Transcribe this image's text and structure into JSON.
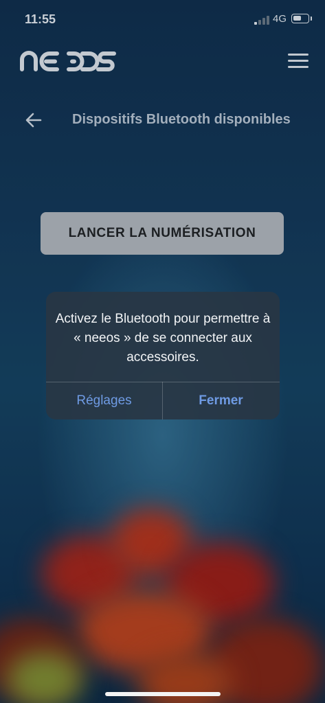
{
  "status_bar": {
    "time": "11:55",
    "network": "4G",
    "battery_level": 0.6,
    "signal_bars_active": 1,
    "signal_bars_total": 4
  },
  "header": {
    "logo_text": "neeos",
    "menu_icon": "hamburger-menu-icon"
  },
  "page": {
    "back_icon": "arrow-left-icon",
    "title": "Dispositifs Bluetooth disponibles"
  },
  "scan_button": {
    "label": "LANCER LA NUMÉRISATION"
  },
  "alert": {
    "message": "Activez le Bluetooth pour permettre à « neeos » de se connecter aux accessoires.",
    "settings_label": "Réglages",
    "close_label": "Fermer"
  },
  "colors": {
    "alert_button": "#6f9be4",
    "scan_button_bg": "#9ca2a9",
    "background": "#153e62"
  }
}
